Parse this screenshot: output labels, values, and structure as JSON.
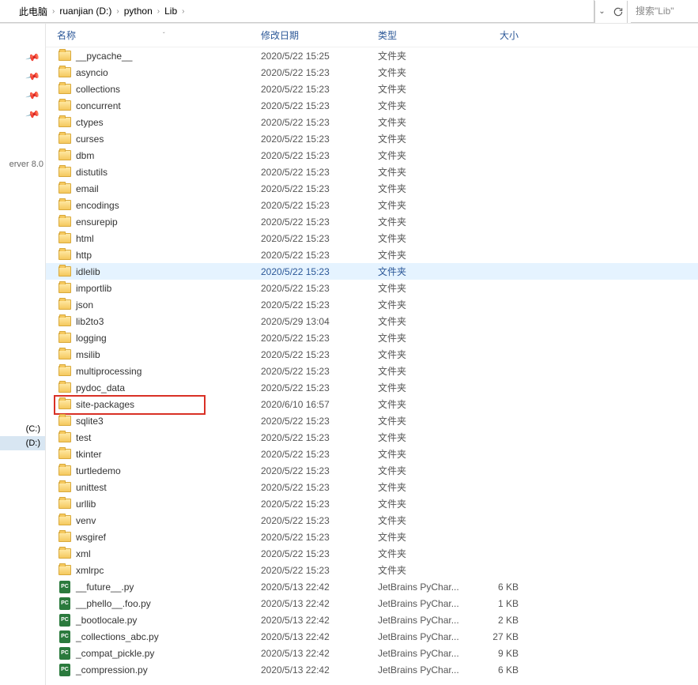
{
  "breadcrumb": {
    "segments": [
      "此电脑",
      "ruanjian (D:)",
      "python",
      "Lib"
    ]
  },
  "search": {
    "placeholder": "搜索\"Lib\""
  },
  "left": {
    "server_label": "erver 8.0",
    "drives": [
      {
        "label": "(C:)",
        "selected": false
      },
      {
        "label": "(D:)",
        "selected": true
      }
    ]
  },
  "columns": {
    "name": "名称",
    "date": "修改日期",
    "type": "类型",
    "size": "大小"
  },
  "rows": [
    {
      "icon": "folder",
      "name": "__pycache__",
      "date": "2020/5/22 15:25",
      "type": "文件夹",
      "size": "",
      "hovered": false,
      "hl": false
    },
    {
      "icon": "folder",
      "name": "asyncio",
      "date": "2020/5/22 15:23",
      "type": "文件夹",
      "size": "",
      "hovered": false,
      "hl": false
    },
    {
      "icon": "folder",
      "name": "collections",
      "date": "2020/5/22 15:23",
      "type": "文件夹",
      "size": "",
      "hovered": false,
      "hl": false
    },
    {
      "icon": "folder",
      "name": "concurrent",
      "date": "2020/5/22 15:23",
      "type": "文件夹",
      "size": "",
      "hovered": false,
      "hl": false
    },
    {
      "icon": "folder",
      "name": "ctypes",
      "date": "2020/5/22 15:23",
      "type": "文件夹",
      "size": "",
      "hovered": false,
      "hl": false
    },
    {
      "icon": "folder",
      "name": "curses",
      "date": "2020/5/22 15:23",
      "type": "文件夹",
      "size": "",
      "hovered": false,
      "hl": false
    },
    {
      "icon": "folder",
      "name": "dbm",
      "date": "2020/5/22 15:23",
      "type": "文件夹",
      "size": "",
      "hovered": false,
      "hl": false
    },
    {
      "icon": "folder",
      "name": "distutils",
      "date": "2020/5/22 15:23",
      "type": "文件夹",
      "size": "",
      "hovered": false,
      "hl": false
    },
    {
      "icon": "folder",
      "name": "email",
      "date": "2020/5/22 15:23",
      "type": "文件夹",
      "size": "",
      "hovered": false,
      "hl": false
    },
    {
      "icon": "folder",
      "name": "encodings",
      "date": "2020/5/22 15:23",
      "type": "文件夹",
      "size": "",
      "hovered": false,
      "hl": false
    },
    {
      "icon": "folder",
      "name": "ensurepip",
      "date": "2020/5/22 15:23",
      "type": "文件夹",
      "size": "",
      "hovered": false,
      "hl": false
    },
    {
      "icon": "folder",
      "name": "html",
      "date": "2020/5/22 15:23",
      "type": "文件夹",
      "size": "",
      "hovered": false,
      "hl": false
    },
    {
      "icon": "folder",
      "name": "http",
      "date": "2020/5/22 15:23",
      "type": "文件夹",
      "size": "",
      "hovered": false,
      "hl": false
    },
    {
      "icon": "folder",
      "name": "idlelib",
      "date": "2020/5/22 15:23",
      "type": "文件夹",
      "size": "",
      "hovered": true,
      "hl": false
    },
    {
      "icon": "folder",
      "name": "importlib",
      "date": "2020/5/22 15:23",
      "type": "文件夹",
      "size": "",
      "hovered": false,
      "hl": false
    },
    {
      "icon": "folder",
      "name": "json",
      "date": "2020/5/22 15:23",
      "type": "文件夹",
      "size": "",
      "hovered": false,
      "hl": false
    },
    {
      "icon": "folder",
      "name": "lib2to3",
      "date": "2020/5/29 13:04",
      "type": "文件夹",
      "size": "",
      "hovered": false,
      "hl": false
    },
    {
      "icon": "folder",
      "name": "logging",
      "date": "2020/5/22 15:23",
      "type": "文件夹",
      "size": "",
      "hovered": false,
      "hl": false
    },
    {
      "icon": "folder",
      "name": "msilib",
      "date": "2020/5/22 15:23",
      "type": "文件夹",
      "size": "",
      "hovered": false,
      "hl": false
    },
    {
      "icon": "folder",
      "name": "multiprocessing",
      "date": "2020/5/22 15:23",
      "type": "文件夹",
      "size": "",
      "hovered": false,
      "hl": false
    },
    {
      "icon": "folder",
      "name": "pydoc_data",
      "date": "2020/5/22 15:23",
      "type": "文件夹",
      "size": "",
      "hovered": false,
      "hl": false
    },
    {
      "icon": "folder",
      "name": "site-packages",
      "date": "2020/6/10 16:57",
      "type": "文件夹",
      "size": "",
      "hovered": false,
      "hl": true
    },
    {
      "icon": "folder",
      "name": "sqlite3",
      "date": "2020/5/22 15:23",
      "type": "文件夹",
      "size": "",
      "hovered": false,
      "hl": false
    },
    {
      "icon": "folder",
      "name": "test",
      "date": "2020/5/22 15:23",
      "type": "文件夹",
      "size": "",
      "hovered": false,
      "hl": false
    },
    {
      "icon": "folder",
      "name": "tkinter",
      "date": "2020/5/22 15:23",
      "type": "文件夹",
      "size": "",
      "hovered": false,
      "hl": false
    },
    {
      "icon": "folder",
      "name": "turtledemo",
      "date": "2020/5/22 15:23",
      "type": "文件夹",
      "size": "",
      "hovered": false,
      "hl": false
    },
    {
      "icon": "folder",
      "name": "unittest",
      "date": "2020/5/22 15:23",
      "type": "文件夹",
      "size": "",
      "hovered": false,
      "hl": false
    },
    {
      "icon": "folder",
      "name": "urllib",
      "date": "2020/5/22 15:23",
      "type": "文件夹",
      "size": "",
      "hovered": false,
      "hl": false
    },
    {
      "icon": "folder",
      "name": "venv",
      "date": "2020/5/22 15:23",
      "type": "文件夹",
      "size": "",
      "hovered": false,
      "hl": false
    },
    {
      "icon": "folder",
      "name": "wsgiref",
      "date": "2020/5/22 15:23",
      "type": "文件夹",
      "size": "",
      "hovered": false,
      "hl": false
    },
    {
      "icon": "folder",
      "name": "xml",
      "date": "2020/5/22 15:23",
      "type": "文件夹",
      "size": "",
      "hovered": false,
      "hl": false
    },
    {
      "icon": "folder",
      "name": "xmlrpc",
      "date": "2020/5/22 15:23",
      "type": "文件夹",
      "size": "",
      "hovered": false,
      "hl": false
    },
    {
      "icon": "file",
      "name": "__future__.py",
      "date": "2020/5/13 22:42",
      "type": "JetBrains PyChar...",
      "size": "6 KB",
      "hovered": false,
      "hl": false
    },
    {
      "icon": "file",
      "name": "__phello__.foo.py",
      "date": "2020/5/13 22:42",
      "type": "JetBrains PyChar...",
      "size": "1 KB",
      "hovered": false,
      "hl": false
    },
    {
      "icon": "file",
      "name": "_bootlocale.py",
      "date": "2020/5/13 22:42",
      "type": "JetBrains PyChar...",
      "size": "2 KB",
      "hovered": false,
      "hl": false
    },
    {
      "icon": "file",
      "name": "_collections_abc.py",
      "date": "2020/5/13 22:42",
      "type": "JetBrains PyChar...",
      "size": "27 KB",
      "hovered": false,
      "hl": false
    },
    {
      "icon": "file",
      "name": "_compat_pickle.py",
      "date": "2020/5/13 22:42",
      "type": "JetBrains PyChar...",
      "size": "9 KB",
      "hovered": false,
      "hl": false
    },
    {
      "icon": "file",
      "name": "_compression.py",
      "date": "2020/5/13 22:42",
      "type": "JetBrains PyChar...",
      "size": "6 KB",
      "hovered": false,
      "hl": false
    }
  ]
}
